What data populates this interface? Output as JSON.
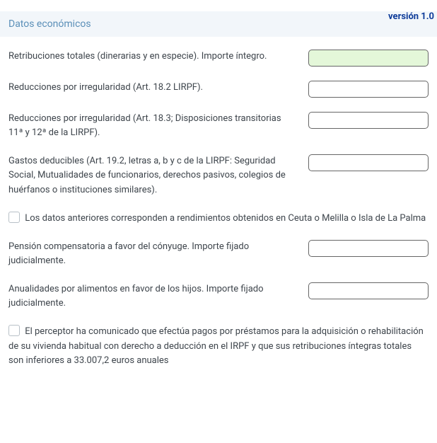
{
  "version_label": "versión 1.0",
  "section_header": "Datos económicos",
  "fields": {
    "retribuciones": "Retribuciones totales (dinerarias y en especie). Importe íntegro.",
    "reducciones_182": "Reducciones por irregularidad (Art. 18.2 LIRPF).",
    "reducciones_183": "Reducciones por irregularidad (Art. 18.3; Disposiciones transitorias 11ª y 12ª de la LIRPF).",
    "gastos_deducibles": "Gastos deducibles (Art. 19.2, letras a, b y c de la LIRPF: Seguridad Social, Mutualidades de funcionarios, derechos pasivos, colegios de huérfanos o instituciones similares).",
    "pension_comp": "Pensión compensatoria a favor del cónyuge. Importe fijado judicialmente.",
    "anualidades": "Anualidades por alimentos en favor de los hijos. Importe fijado judicialmente."
  },
  "checkboxes": {
    "ceuta_melilla": "Los datos anteriores corresponden a rendimientos obtenidos en Ceuta o Melilla o Isla de La Palma",
    "prestamos": "El perceptor ha comunicado que efectúa pagos por préstamos para la adquisición o rehabilitación de su vivienda habitual con derecho a deducción en el IRPF y que sus retribuciones íntegras totales son inferiores a 33.007,2 euros anuales"
  }
}
